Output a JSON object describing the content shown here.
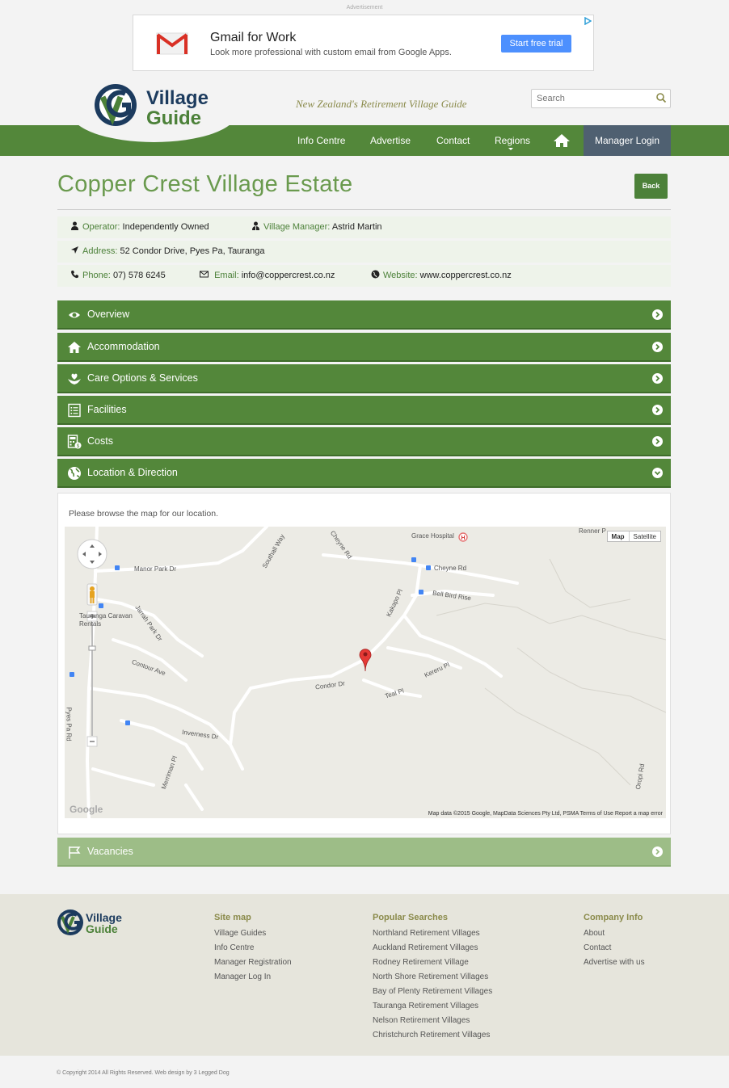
{
  "ad": {
    "label": "Advertisement",
    "title": "Gmail for Work",
    "subtitle": "Look more professional with custom email from Google Apps.",
    "cta": "Start free trial"
  },
  "header": {
    "logo_top": "Village",
    "logo_bottom": "Guide",
    "tagline": "New Zealand's Retirement Village Guide",
    "search_placeholder": "Search"
  },
  "nav": {
    "items": [
      "Info Centre",
      "Advertise",
      "Contact",
      "Regions"
    ],
    "manager_login": "Manager Login"
  },
  "listing": {
    "title": "Copper Crest Village Estate",
    "back": "Back",
    "operator_label": "Operator:",
    "operator": "Independently Owned",
    "manager_label": "Village Manager:",
    "manager": "Astrid Martin",
    "address_label": "Address:",
    "address": "52 Condor Drive, Pyes Pa, Tauranga",
    "phone_label": "Phone:",
    "phone": "07) 578 6245",
    "email_label": "Email:",
    "email": "info@coppercrest.co.nz",
    "website_label": "Website:",
    "website": "www.coppercrest.co.nz"
  },
  "sections": [
    {
      "label": "Overview",
      "icon": "eye-icon"
    },
    {
      "label": "Accommodation",
      "icon": "home-icon"
    },
    {
      "label": "Care Options & Services",
      "icon": "care-hands-icon"
    },
    {
      "label": "Facilities",
      "icon": "list-icon"
    },
    {
      "label": "Costs",
      "icon": "calculator-icon"
    },
    {
      "label": "Location & Direction",
      "icon": "globe-icon"
    },
    {
      "label": "Vacancies",
      "icon": "flag-icon"
    }
  ],
  "location": {
    "intro": "Please browse the map for our location.",
    "map_type": [
      "Map",
      "Satellite"
    ],
    "attribution": "Map data ©2015 Google, MapData Sciences Pty Ltd, PSMA   Terms of Use   Report a map error",
    "google": "Google",
    "streets": [
      "Grace Hospital",
      "Cheyne Rd",
      "Manor Park Dr",
      "Southall Way",
      "Cheyne Rd",
      "Kakapo Pl",
      "Bell Bird Rise",
      "Tauranga Caravan Rentals",
      "Jarrah Park Dr",
      "Contour Ave",
      "Condor Dr",
      "Teal Pl",
      "Kereru Pl",
      "Inverness Dr",
      "Merriman Pl",
      "Pyes Pa Rd",
      "Oropi Rd",
      "Renner P"
    ]
  },
  "footer": {
    "sitemap_title": "Site map",
    "sitemap": [
      "Village Guides",
      "Info Centre",
      "Manager Registration",
      "Manager Log In"
    ],
    "popular_title": "Popular Searches",
    "popular": [
      "Northland Retirement Villages",
      "Auckland Retirement Villages",
      "Rodney Retirement Village",
      "North Shore Retirement Villages",
      "Bay of Plenty Retirement Villages",
      "Tauranga Retirement Villages",
      "Nelson Retirement Villages",
      "Christchurch Retirement Villages"
    ],
    "company_title": "Company Info",
    "company": [
      "About",
      "Contact",
      "Advertise with us"
    ],
    "copyright": "© Copyright 2014 All Rights Reserved. Web design by 3 Legged Dog"
  },
  "colors": {
    "brand_green": "#53873a",
    "login_slate": "#4f6071",
    "light_green": "#9dbd87"
  }
}
